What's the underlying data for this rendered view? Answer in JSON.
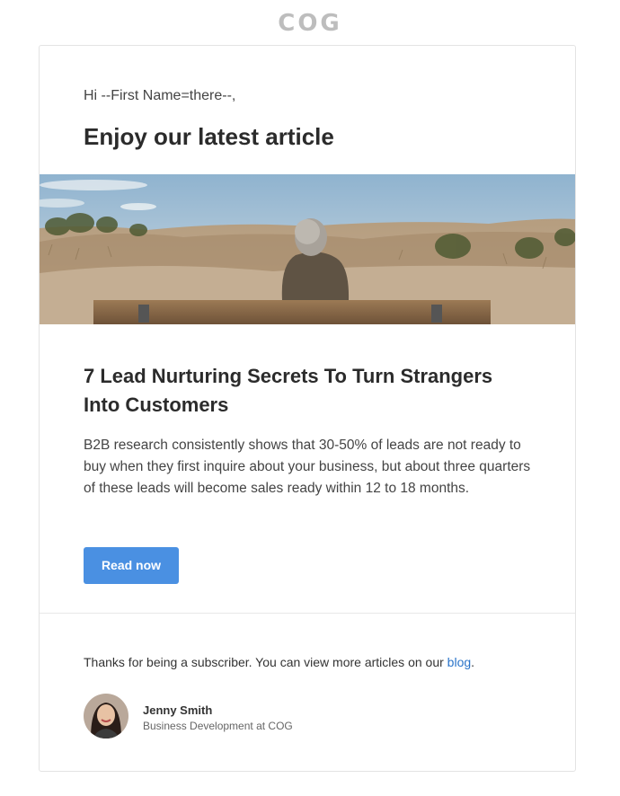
{
  "header": {
    "logo_text": "COG"
  },
  "email": {
    "greeting": "Hi --First Name=there--,",
    "headline": "Enjoy our latest article",
    "article": {
      "title": "7 Lead Nurturing Secrets To Turn Strangers Into Customers",
      "body": "B2B research consistently shows that 30-50% of leads are not ready to buy when they first inquire about your business, but about three quarters of these leads will become sales ready within 12 to 18 months."
    },
    "cta": {
      "label": "Read now"
    },
    "footer": {
      "text": "Thanks for being a subscriber. You can view more articles on our ",
      "link_label": "blog",
      "period": "."
    },
    "sender": {
      "name": "Jenny Smith",
      "role": "Business Development at COG"
    }
  },
  "colors": {
    "button": "#4a90e2",
    "link": "#2a74c9",
    "logo": "#bdbdbd"
  }
}
